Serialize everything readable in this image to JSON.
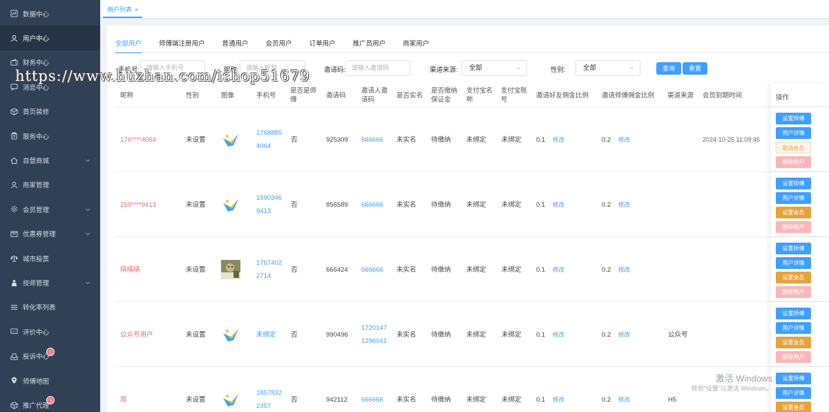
{
  "sidebar": {
    "items": [
      {
        "label": "数据中心",
        "icon": "chart-icon"
      },
      {
        "label": "用户中心",
        "icon": "user-icon"
      },
      {
        "label": "财务中心",
        "icon": "wallet-icon"
      },
      {
        "label": "消息中心",
        "icon": "message-icon"
      },
      {
        "label": "首页装修",
        "icon": "cube-icon"
      },
      {
        "label": "服务中心",
        "icon": "clipboard-icon"
      },
      {
        "label": "自营商城",
        "icon": "home-icon"
      },
      {
        "label": "商家管理",
        "icon": "user-icon"
      },
      {
        "label": "会员管理",
        "icon": "settings-icon"
      },
      {
        "label": "优惠券管理",
        "icon": "coupon-icon"
      },
      {
        "label": "城市投票",
        "icon": "vote-icon"
      },
      {
        "label": "技师管理",
        "icon": "person-icon"
      },
      {
        "label": "转化率列表",
        "icon": "list-icon"
      },
      {
        "label": "评价中心",
        "icon": "comment-icon"
      },
      {
        "label": "投诉中心",
        "icon": "inbox-icon",
        "badge": "1"
      },
      {
        "label": "师傅地图",
        "icon": "location-icon"
      },
      {
        "label": "推广代理",
        "icon": "cube-icon",
        "badge": "5"
      }
    ]
  },
  "topbar": {
    "tab_label": "用户列表",
    "close": "×"
  },
  "tabs": [
    "全部用户",
    "师傅端注册用户",
    "普通用户",
    "会员用户",
    "订单用户",
    "推广员用户",
    "商家用户"
  ],
  "filters": {
    "phone_label": "手机号:",
    "phone_placeholder": "请输入手机号",
    "nick_label": "昵称:",
    "nick_placeholder": "请输入昵称",
    "invite_label": "邀请码:",
    "invite_placeholder": "请输入邀请码",
    "channel_label": "渠道来源:",
    "channel_value": "全部",
    "gender_label": "性别:",
    "gender_value": "全部",
    "query_btn": "查询",
    "reset_btn": "重置"
  },
  "table": {
    "headers": [
      "昵称",
      "性别",
      "图像",
      "手机号",
      "是否是师傅",
      "邀请码",
      "邀请人邀请码",
      "是否实名",
      "是否缴纳保证金",
      "支付宝名称",
      "支付宝账号",
      "邀请好友佣金比例",
      "邀请师傅佣金比例",
      "渠道来源",
      "会员到期时间",
      "操作"
    ],
    "modify": "修改",
    "rows": [
      {
        "nick": "176****4064",
        "gender": "未设置",
        "avatar": "logo",
        "phone": "1768885\n4064",
        "is_master": "否",
        "code": "925309",
        "inviter": "666666",
        "realname": "未实名",
        "deposit": "待缴纳",
        "alipay_name": "未绑定",
        "alipay_acc": "未绑定",
        "friend_rate": "0.1",
        "master_rate": "0.2",
        "channel": "",
        "expire": "2024-10-25 11:09:45",
        "member_btn": "取消会员"
      },
      {
        "nick": "159****9413",
        "gender": "未设置",
        "avatar": "logo",
        "phone": "1590346\n9413",
        "is_master": "否",
        "code": "856589",
        "inviter": "666666",
        "realname": "未实名",
        "deposit": "待缴纳",
        "alipay_name": "未绑定",
        "alipay_acc": "未绑定",
        "friend_rate": "0.1",
        "master_rate": "0.2",
        "channel": "",
        "expire": "",
        "member_btn": "设置会员"
      },
      {
        "nick": "晴晴晴",
        "gender": "未设置",
        "avatar": "photo",
        "phone": "1767402\n2714",
        "is_master": "否",
        "code": "666424",
        "inviter": "666666",
        "realname": "未实名",
        "deposit": "待缴纳",
        "alipay_name": "未绑定",
        "alipay_acc": "未绑定",
        "friend_rate": "0.1",
        "master_rate": "0.2",
        "channel": "",
        "expire": "",
        "member_btn": "设置会员"
      },
      {
        "nick": "公众号用户",
        "gender": "未设置",
        "avatar": "logo",
        "phone": "未绑定",
        "is_master": "否",
        "code": "990496",
        "inviter": "1720147\n1296041",
        "realname": "未实名",
        "deposit": "待缴纳",
        "alipay_name": "未绑定",
        "alipay_acc": "未绑定",
        "friend_rate": "0.1",
        "master_rate": "0.2",
        "channel": "公众号",
        "expire": "",
        "member_btn": "设置会员"
      },
      {
        "nick": "周",
        "gender": "未设置",
        "avatar": "logo",
        "phone": "1857832\n2357",
        "is_master": "否",
        "code": "942112",
        "inviter": "666666",
        "realname": "未实名",
        "deposit": "待缴纳",
        "alipay_name": "未绑定",
        "alipay_acc": "未绑定",
        "friend_rate": "0.1",
        "master_rate": "0.2",
        "channel": "H5",
        "expire": "",
        "member_btn": "设置会员"
      }
    ],
    "op_buttons": {
      "set_master": "设置师傅",
      "detail": "用户详情",
      "delete": "删除用户"
    }
  },
  "watermark": "https://www.huzhan.com/ishop51679",
  "windows": {
    "line1": "激活 Windows",
    "line2": "转到\"设置\"以激活 Windows。"
  }
}
